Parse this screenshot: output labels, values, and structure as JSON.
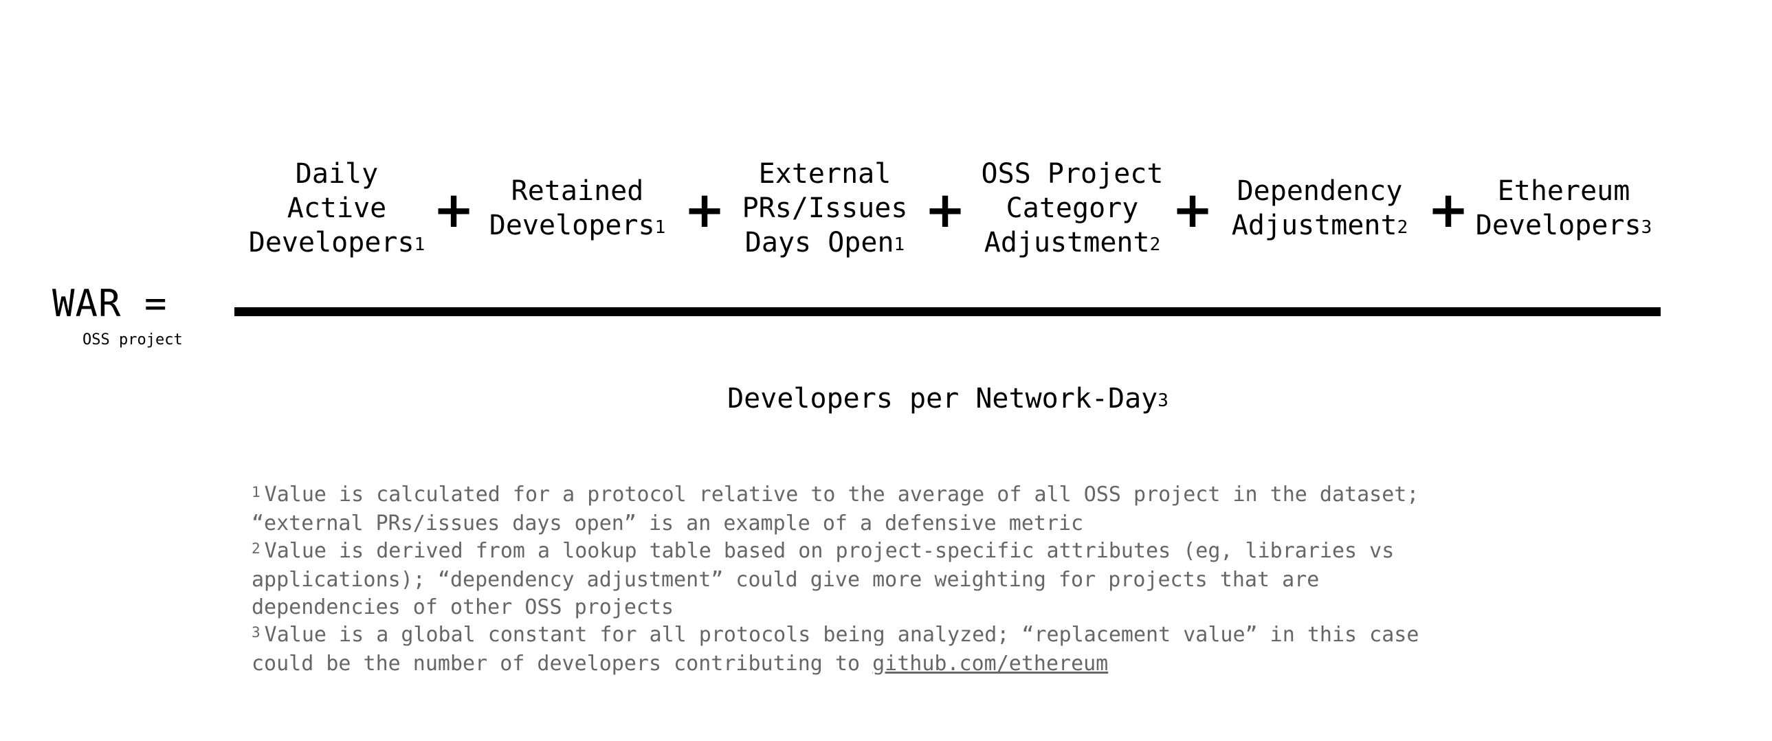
{
  "lhs": {
    "war": "WAR =",
    "subscript": "OSS project"
  },
  "numerator": {
    "terms": [
      {
        "label": "Daily\nActive\nDevelopers",
        "note": "1"
      },
      {
        "label": "Retained\nDevelopers",
        "note": "1"
      },
      {
        "label": "External\nPRs/Issues\nDays Open",
        "note": "1"
      },
      {
        "label": "OSS Project\nCategory\nAdjustment",
        "note": "2"
      },
      {
        "label": "Dependency\nAdjustment",
        "note": "2"
      },
      {
        "label": "Ethereum\nDevelopers",
        "note": "3"
      }
    ],
    "operator": "+"
  },
  "denominator": {
    "label": "Developers per Network-Day",
    "note": "3"
  },
  "footnotes": [
    {
      "mark": "1",
      "text": "Value is calculated for a protocol relative to the average of all OSS project in the dataset; “external PRs/issues days open” is an example of a defensive metric"
    },
    {
      "mark": "2",
      "text": "Value is derived from a lookup table based on project-specific attributes (eg, libraries vs applications); “dependency adjustment” could give more weighting for projects that are dependencies of other OSS projects"
    },
    {
      "mark": "3",
      "text": "Value is a global constant for all protocols being analyzed; “replacement value” in this case could be the number of developers contributing to",
      "link": "github.com/ethereum"
    }
  ]
}
